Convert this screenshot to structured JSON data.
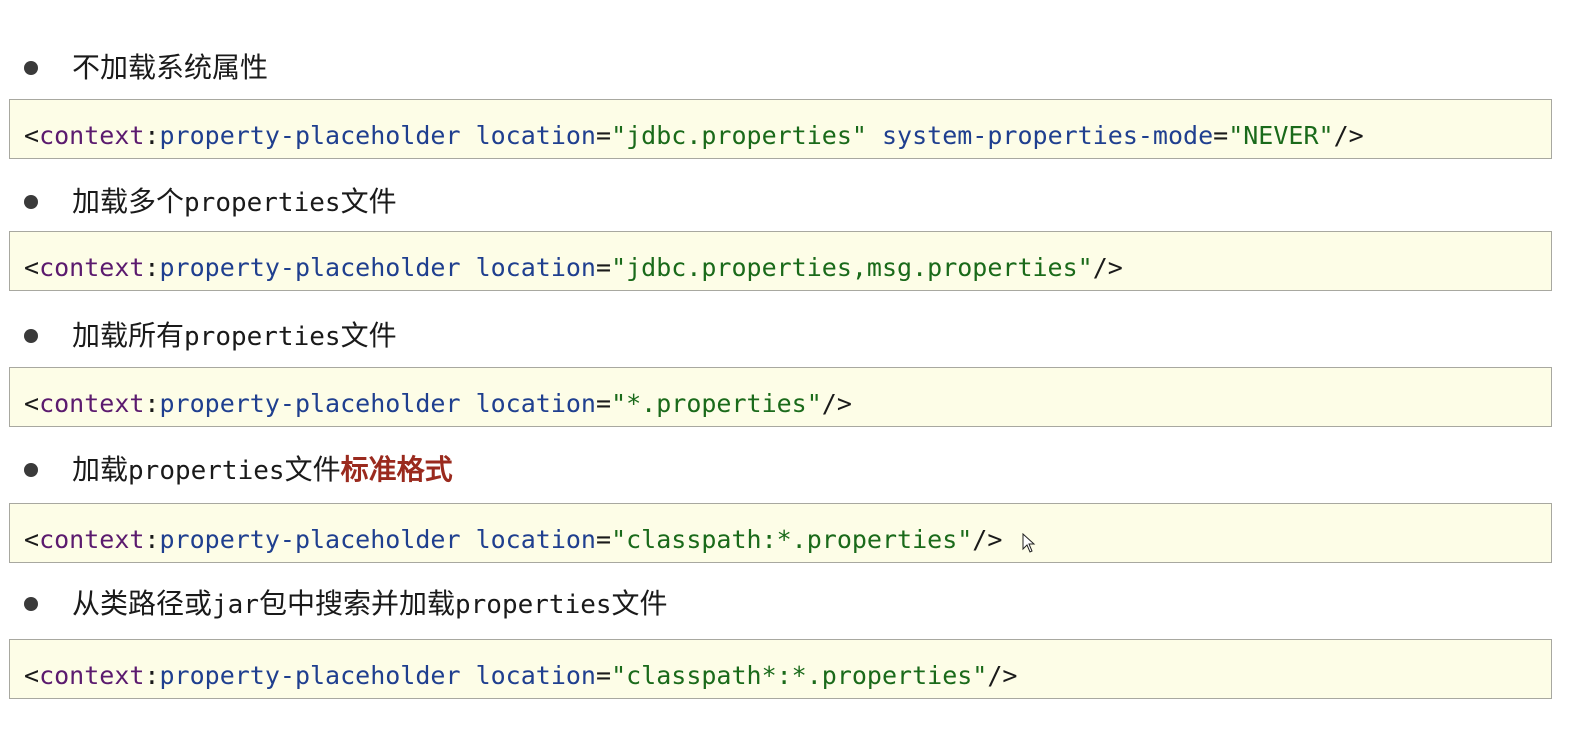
{
  "items": [
    {
      "bullet": {
        "parts": [
          {
            "text": "不加载系统属性",
            "style": "normal"
          }
        ]
      },
      "code": {
        "open": "<",
        "ns": "context",
        "colon": ":",
        "tag": "property-placeholder",
        "attrs": [
          {
            "name": "location",
            "value": "\"jdbc.properties\""
          },
          {
            "name": "system-properties-mode",
            "value": "\"NEVER\""
          }
        ],
        "close": "/>"
      }
    },
    {
      "bullet": {
        "parts": [
          {
            "text": "加载多个",
            "style": "normal"
          },
          {
            "text": "properties",
            "style": "mono"
          },
          {
            "text": "文件",
            "style": "normal"
          }
        ]
      },
      "code": {
        "open": "<",
        "ns": "context",
        "colon": ":",
        "tag": "property-placeholder",
        "attrs": [
          {
            "name": "location",
            "value": "\"jdbc.properties,msg.properties\""
          }
        ],
        "close": "/>"
      }
    },
    {
      "bullet": {
        "parts": [
          {
            "text": "加载所有",
            "style": "normal"
          },
          {
            "text": "properties",
            "style": "mono"
          },
          {
            "text": "文件",
            "style": "normal"
          }
        ]
      },
      "code": {
        "open": "<",
        "ns": "context",
        "colon": ":",
        "tag": "property-placeholder",
        "attrs": [
          {
            "name": "location",
            "value": "\"*.properties\""
          }
        ],
        "close": "/>"
      }
    },
    {
      "bullet": {
        "parts": [
          {
            "text": "加载",
            "style": "normal"
          },
          {
            "text": "properties",
            "style": "mono"
          },
          {
            "text": "文件",
            "style": "normal"
          },
          {
            "text": "标准格式",
            "style": "emph"
          }
        ]
      },
      "code": {
        "open": "<",
        "ns": "context",
        "colon": ":",
        "tag": "property-placeholder",
        "attrs": [
          {
            "name": "location",
            "value": "\"classpath:*.properties\""
          }
        ],
        "close": "/>"
      }
    },
    {
      "bullet": {
        "parts": [
          {
            "text": "从类路径或",
            "style": "normal"
          },
          {
            "text": "jar",
            "style": "mono"
          },
          {
            "text": "包中搜索并加载",
            "style": "normal"
          },
          {
            "text": "properties",
            "style": "mono"
          },
          {
            "text": "文件",
            "style": "normal"
          }
        ]
      },
      "code": {
        "open": "<",
        "ns": "context",
        "colon": ":",
        "tag": "property-placeholder",
        "attrs": [
          {
            "name": "location",
            "value": "\"classpath*:*.properties\""
          }
        ],
        "close": "/>"
      }
    }
  ],
  "colors": {
    "code_background": "#fdfde7",
    "namespace": "#5b1a6e",
    "tag_and_attr": "#1f3f8f",
    "string_value": "#1a6a1a",
    "emphasis": "#9a2a1e"
  },
  "cursor": {
    "icon": "mouse-pointer-icon"
  }
}
